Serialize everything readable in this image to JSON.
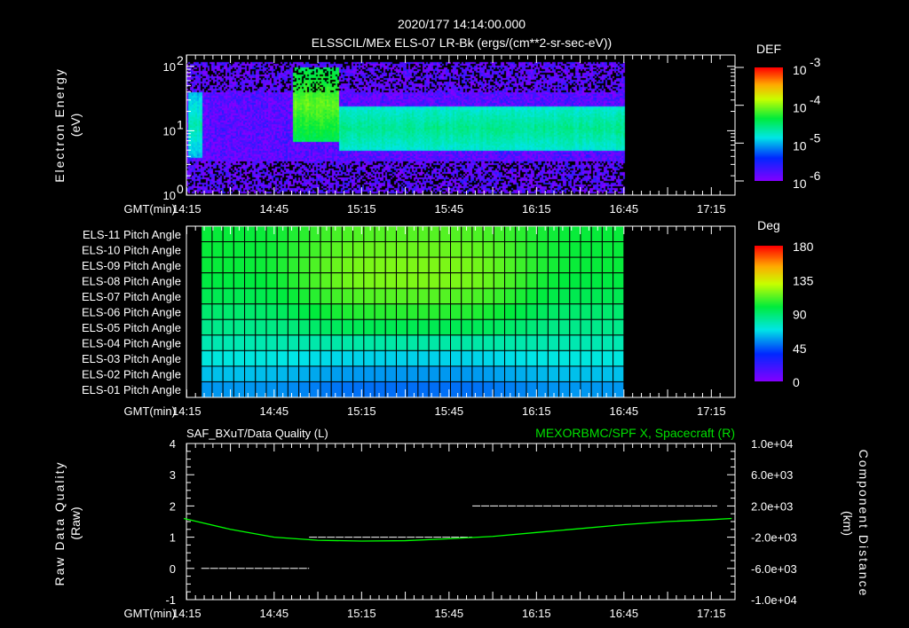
{
  "header": {
    "timestamp": "2020/177 14:14:00.000",
    "title": "ELSSCIL/MEx ELS-07 LR-Bk  (ergs/(cm**2-sr-sec-eV))"
  },
  "chart_data": [
    {
      "type": "heatmap",
      "name": "energy-spectrogram",
      "ylabel": "Electron Energy",
      "ylabel_unit": "(eV)",
      "xlabel": "GMT(min)",
      "x_ticks": [
        "14:15",
        "14:45",
        "15:15",
        "15:45",
        "16:15",
        "16:45",
        "17:15"
      ],
      "y_scale": "log",
      "ylim": [
        1,
        150
      ],
      "y_ticks": [
        "10^0",
        "10^1",
        "10^2"
      ],
      "y_tick_base": "10",
      "y_tick_exps": [
        "0",
        "1",
        "2"
      ],
      "data_time_range": [
        "14:18",
        "16:45"
      ],
      "colorbar": {
        "title": "DEF",
        "scale": "log",
        "range": [
          1e-06,
          0.001
        ],
        "tick_exps": [
          "-3",
          "-4",
          "-5",
          "-6"
        ],
        "tick_base": "10"
      },
      "features": [
        {
          "time_range": [
            "14:15",
            "14:20"
          ],
          "energy_range": [
            4,
            40
          ],
          "level": 2e-05
        },
        {
          "time_range": [
            "14:51",
            "15:07"
          ],
          "energy_range": [
            7,
            100
          ],
          "level": 8e-05
        },
        {
          "time_range": [
            "15:07",
            "16:45"
          ],
          "energy_range": [
            5,
            25
          ],
          "level": 2.5e-05
        }
      ]
    },
    {
      "type": "heatmap",
      "name": "pitch-angle-grid",
      "xlabel": "GMT(min)",
      "x_ticks": [
        "14:15",
        "14:45",
        "15:15",
        "15:45",
        "16:15",
        "16:45",
        "17:15"
      ],
      "rows": [
        "ELS-11 Pitch Angle",
        "ELS-10 Pitch Angle",
        "ELS-09 Pitch Angle",
        "ELS-08 Pitch Angle",
        "ELS-07 Pitch Angle",
        "ELS-06 Pitch Angle",
        "ELS-05 Pitch Angle",
        "ELS-04 Pitch Angle",
        "ELS-03 Pitch Angle",
        "ELS-02 Pitch Angle",
        "ELS-01 Pitch Angle"
      ],
      "row_edge_values_deg": [
        100,
        100,
        100,
        98,
        95,
        90,
        85,
        78,
        70,
        62,
        55
      ],
      "row_mid_values_deg": [
        112,
        115,
        118,
        118,
        112,
        105,
        95,
        80,
        65,
        55,
        48
      ],
      "data_time_range": [
        "14:20",
        "16:45"
      ],
      "colorbar": {
        "title": "Deg",
        "range": [
          0,
          180
        ],
        "ticks": [
          "180",
          "135",
          "90",
          "45",
          "0"
        ]
      }
    },
    {
      "type": "line",
      "name": "quality-and-position",
      "title_left": "SAF_BXuT/Data Quality (L)",
      "title_right": "MEXORBMC/SPF X, Spacecraft (R)",
      "ylabel_left": "Raw Data Quality",
      "ylabel_left_unit": "(Raw)",
      "ylabel_right": "Component Distance",
      "ylabel_right_unit": "(km)",
      "xlabel": "GMT(min)",
      "x_ticks": [
        "14:15",
        "14:45",
        "15:15",
        "15:45",
        "16:15",
        "16:45",
        "17:15"
      ],
      "ylim_left": [
        -1,
        4
      ],
      "y_ticks_left": [
        "4",
        "3",
        "2",
        "1",
        "0",
        "-1"
      ],
      "ylim_right": [
        -10000,
        10000
      ],
      "y_ticks_right": [
        "1.0e+04",
        "6.0e+03",
        "2.0e+03",
        "-2.0e+03",
        "-6.0e+03",
        "-1.0e+04"
      ],
      "series": [
        {
          "name": "Data Quality",
          "color": "#ffffff",
          "axis": "left",
          "segments": [
            {
              "from": "14:20",
              "to": "14:57",
              "value": 0
            },
            {
              "from": "14:57",
              "to": "15:53",
              "value": 1
            },
            {
              "from": "15:53",
              "to": "17:17",
              "value": 2
            }
          ]
        },
        {
          "name": "SPF X",
          "color": "#00ff00",
          "axis": "right",
          "x": [
            "14:14",
            "14:30",
            "14:45",
            "15:00",
            "15:15",
            "15:30",
            "15:45",
            "16:00",
            "16:15",
            "16:30",
            "16:45",
            "17:00",
            "17:15",
            "17:22"
          ],
          "y": [
            400,
            -1000,
            -2000,
            -2400,
            -2500,
            -2450,
            -2200,
            -1900,
            -1400,
            -900,
            -400,
            0,
            250,
            400
          ]
        }
      ]
    }
  ]
}
